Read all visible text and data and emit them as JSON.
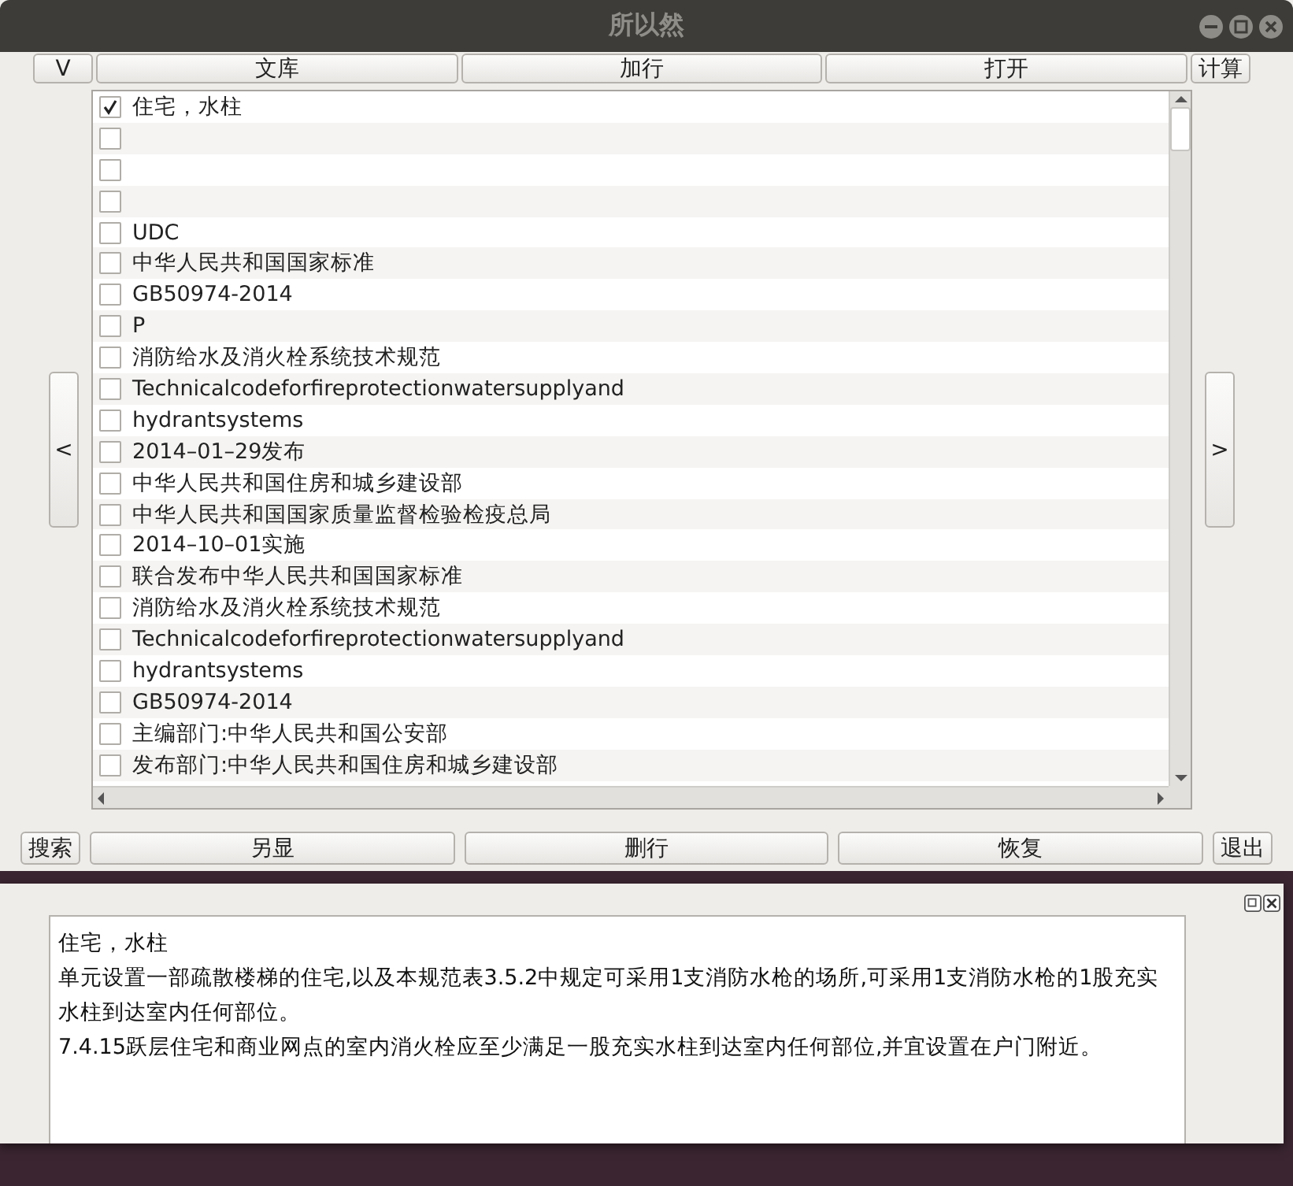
{
  "window": {
    "title": "所以然"
  },
  "top_buttons": [
    "V",
    "文库",
    "加行",
    "打开",
    "计算"
  ],
  "nav": {
    "prev": "<",
    "next": ">"
  },
  "list_items": [
    {
      "text": "住宅，水柱",
      "checked": true
    },
    {
      "checked": false
    },
    {
      "checked": false
    },
    {
      "checked": false
    },
    {
      "text": "UDC",
      "checked": false
    },
    {
      "text": "中华人民共和国国家标准",
      "checked": false
    },
    {
      "text": "GB50974-2014",
      "checked": false
    },
    {
      "text": "P",
      "checked": false
    },
    {
      "text": "消防给水及消火栓系统技术规范",
      "checked": false
    },
    {
      "text": "Technicalcodeforfireprotectionwatersupplyand",
      "checked": false
    },
    {
      "text": "hydrantsystems",
      "checked": false
    },
    {
      "text": "2014–01–29发布",
      "checked": false
    },
    {
      "text": "中华人民共和国住房和城乡建设部",
      "checked": false
    },
    {
      "text": "中华人民共和国国家质量监督检验检疫总局",
      "checked": false
    },
    {
      "text": "2014–10–01实施",
      "checked": false
    },
    {
      "text": "联合发布中华人民共和国国家标准",
      "checked": false
    },
    {
      "text": "消防给水及消火栓系统技术规范",
      "checked": false
    },
    {
      "text": "Technicalcodeforfireprotectionwatersupplyand",
      "checked": false
    },
    {
      "text": "hydrantsystems",
      "checked": false
    },
    {
      "text": "GB50974-2014",
      "checked": false
    },
    {
      "text": "主编部门:中华人民共和国公安部",
      "checked": false
    },
    {
      "text": "发布部门:中华人民共和国住房和城乡建设部",
      "checked": false
    }
  ],
  "bottom_buttons": [
    "搜索",
    "另显",
    "删行",
    "恢复",
    "退出"
  ],
  "detail_panel": {
    "lines": [
      "住宅，水柱",
      "单元设置一部疏散楼梯的住宅,以及本规范表3.5.2中规定可采用1支消防水枪的场所,可采用1支消防水枪的1股充实水柱到达室内任何部位。",
      "7.4.15跃层住宅和商业网点的室内消火栓应至少满足一股充实水柱到达室内任何部位,并宜设置在户门附近。"
    ]
  }
}
